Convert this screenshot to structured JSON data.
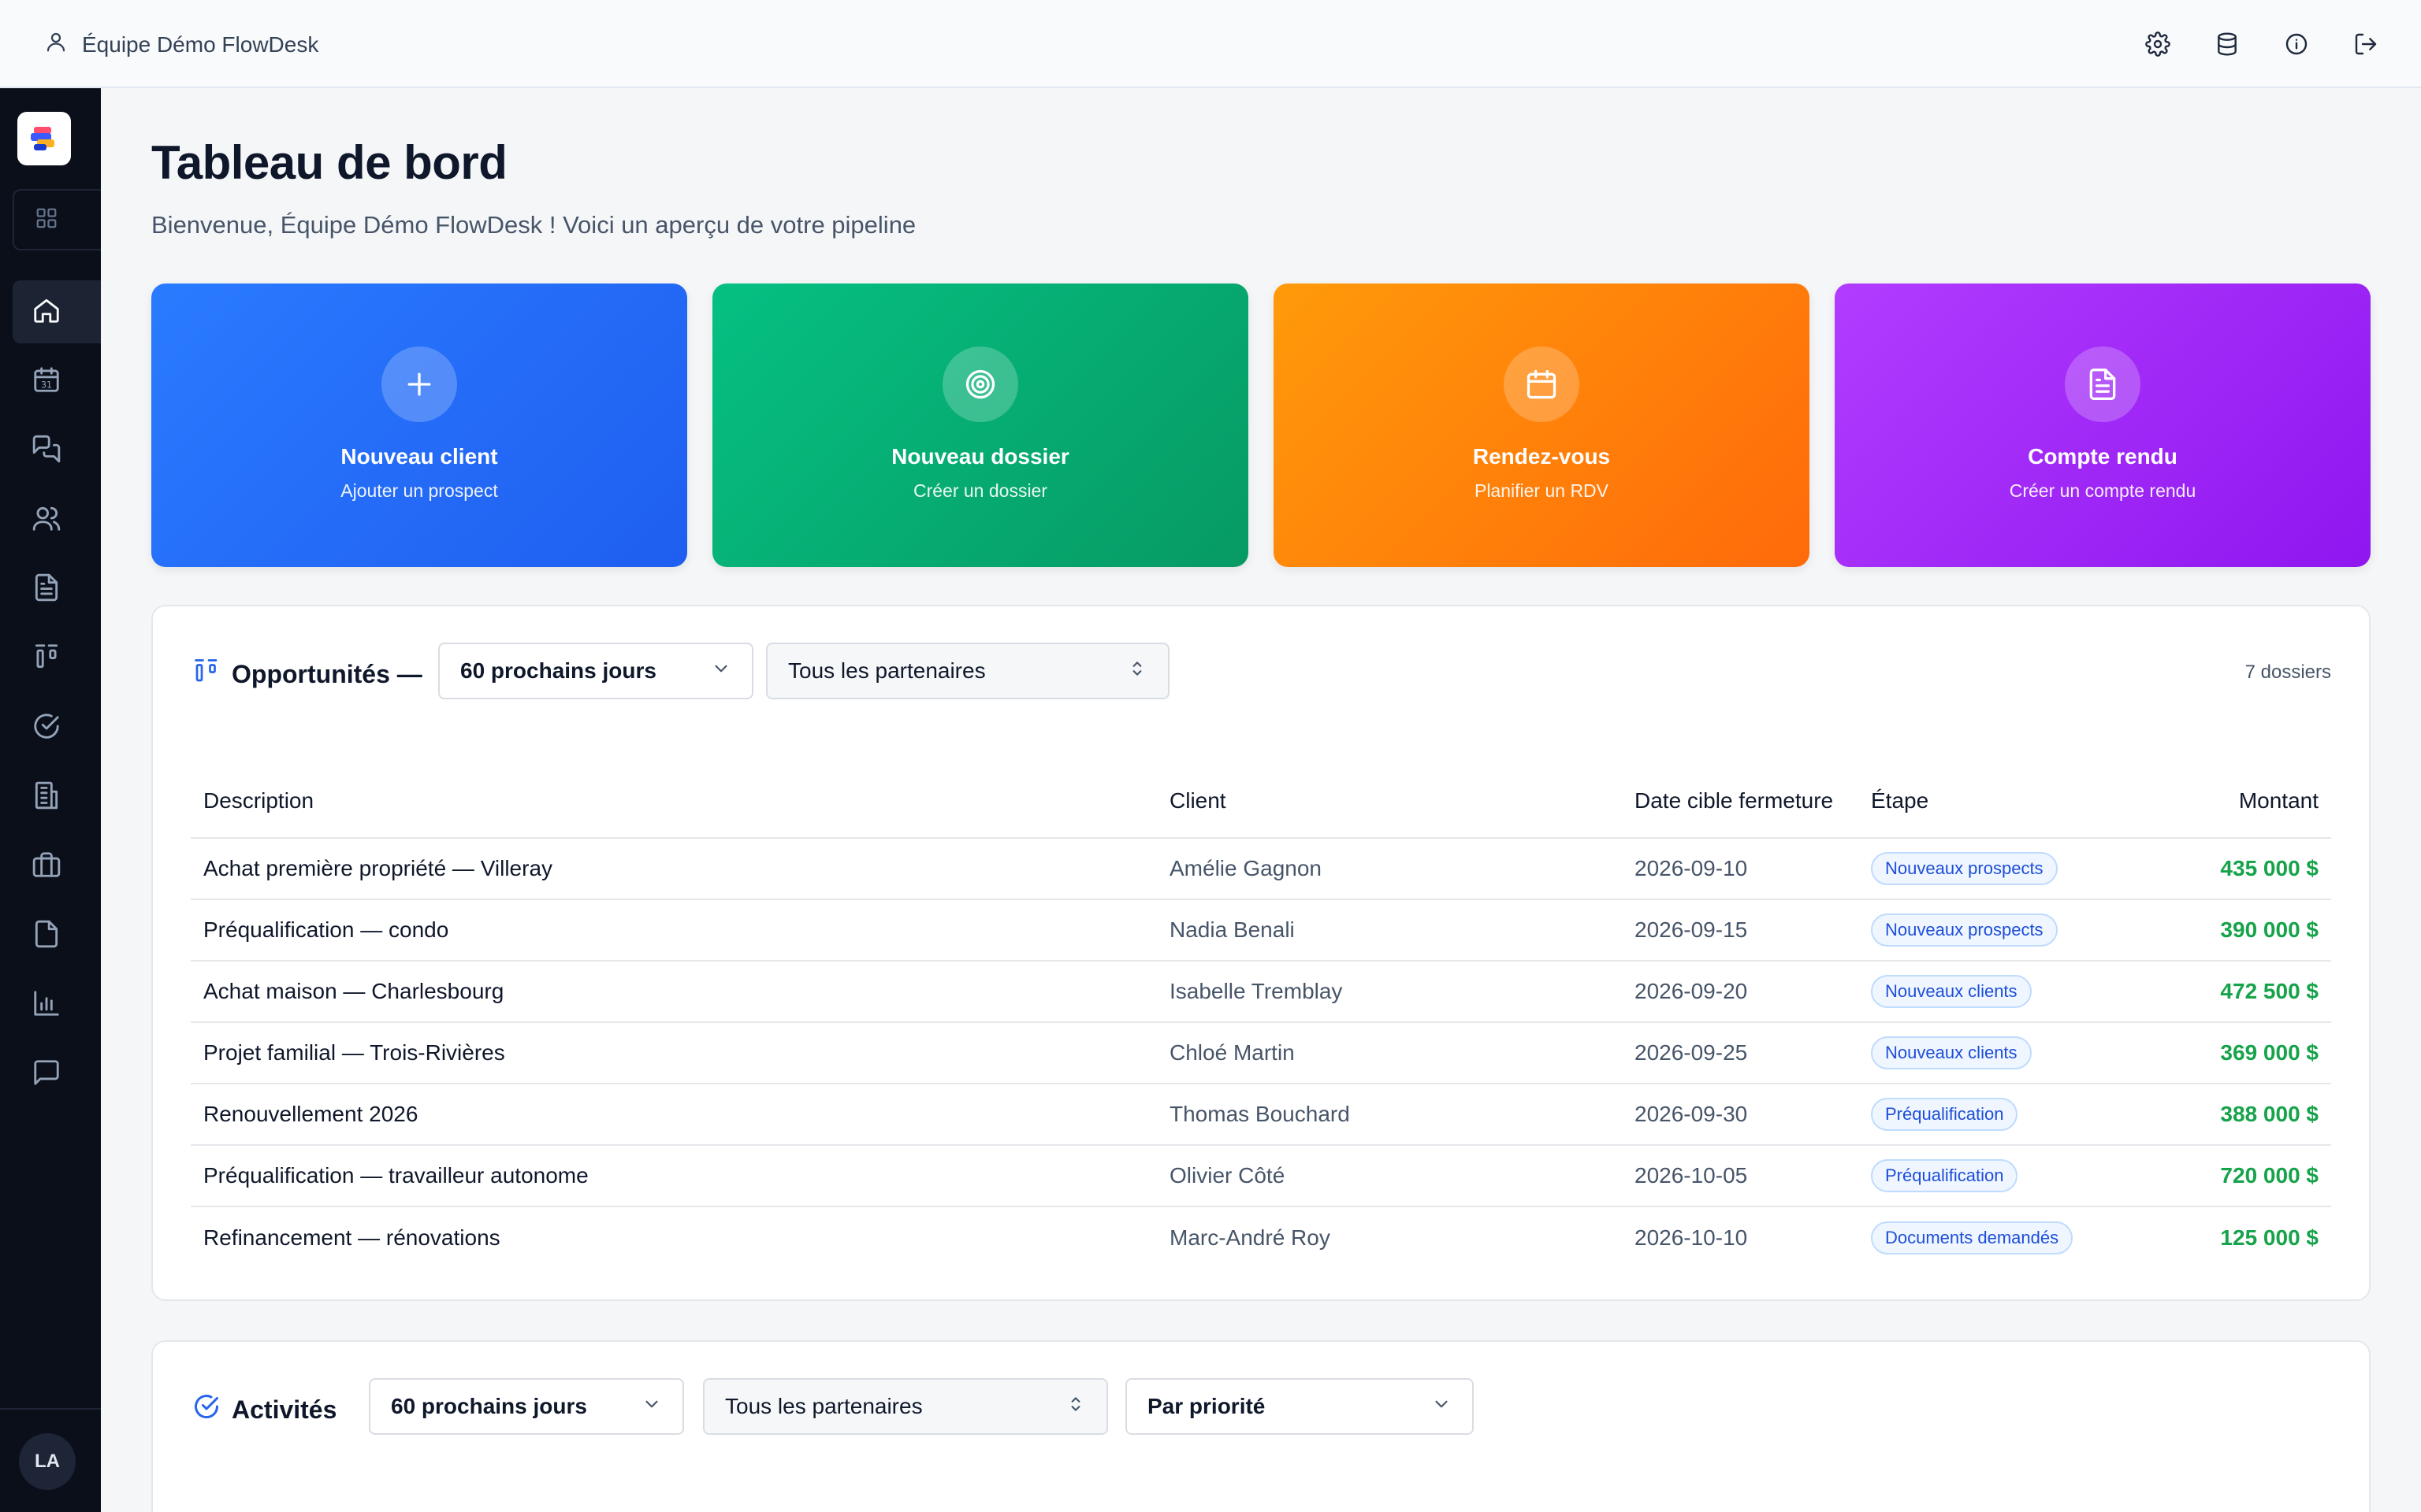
{
  "topbar": {
    "team_name": "Équipe Démo FlowDesk",
    "icons": [
      "gear-icon",
      "database-icon",
      "info-icon",
      "logout-icon"
    ]
  },
  "sidebar": {
    "nav_icons": [
      "home-icon",
      "calendar-icon",
      "chat-icon",
      "users-icon",
      "document-icon",
      "kanban-icon",
      "check-circle-icon",
      "building-icon",
      "briefcase-icon",
      "file-icon",
      "bar-chart-icon",
      "message-icon"
    ],
    "calendar_day": "31",
    "avatar": "LA"
  },
  "header": {
    "title": "Tableau de bord",
    "subtitle": "Bienvenue, Équipe Démo FlowDesk ! Voici un aperçu de votre pipeline"
  },
  "quick_actions": [
    {
      "title": "Nouveau client",
      "subtitle": "Ajouter un prospect",
      "icon": "plus-icon",
      "color": "#2a7bff"
    },
    {
      "title": "Nouveau dossier",
      "subtitle": "Créer un dossier",
      "icon": "target-icon",
      "color": "#05c082"
    },
    {
      "title": "Rendez-vous",
      "subtitle": "Planifier un RDV",
      "icon": "calendar-icon",
      "color": "#ff9a0a"
    },
    {
      "title": "Compte rendu",
      "subtitle": "Créer un compte rendu",
      "icon": "file-text-icon",
      "color": "#b23cff"
    }
  ],
  "opportunities": {
    "title": "Opportunités —",
    "period": "60 prochains jours",
    "partners": "Tous les partenaires",
    "count": "7 dossiers",
    "columns": [
      "Description",
      "Client",
      "Date cible fermeture",
      "Étape",
      "Montant"
    ],
    "rows": [
      {
        "description": "Achat première propriété — Villeray",
        "client": "Amélie Gagnon",
        "date": "2026-09-10",
        "stage": "Nouveaux prospects",
        "amount": "435 000 $"
      },
      {
        "description": "Préqualification — condo",
        "client": "Nadia Benali",
        "date": "2026-09-15",
        "stage": "Nouveaux prospects",
        "amount": "390 000 $"
      },
      {
        "description": "Achat maison — Charlesbourg",
        "client": "Isabelle Tremblay",
        "date": "2026-09-20",
        "stage": "Nouveaux clients",
        "amount": "472 500 $"
      },
      {
        "description": "Projet familial — Trois-Rivières",
        "client": "Chloé Martin",
        "date": "2026-09-25",
        "stage": "Nouveaux clients",
        "amount": "369 000 $"
      },
      {
        "description": "Renouvellement 2026",
        "client": "Thomas Bouchard",
        "date": "2026-09-30",
        "stage": "Préqualification",
        "amount": "388 000 $"
      },
      {
        "description": "Préqualification — travailleur autonome",
        "client": "Olivier Côté",
        "date": "2026-10-05",
        "stage": "Préqualification",
        "amount": "720 000 $"
      },
      {
        "description": "Refinancement — rénovations",
        "client": "Marc-André Roy",
        "date": "2026-10-10",
        "stage": "Documents demandés",
        "amount": "125 000 $"
      }
    ]
  },
  "activities": {
    "title": "Activités",
    "period": "60 prochains jours",
    "partners": "Tous les partenaires",
    "sort": "Par priorité"
  },
  "colors": {
    "accent": "#2563eb",
    "amount_green": "#16a34a",
    "sidebar_bg": "#0b0f1a"
  }
}
